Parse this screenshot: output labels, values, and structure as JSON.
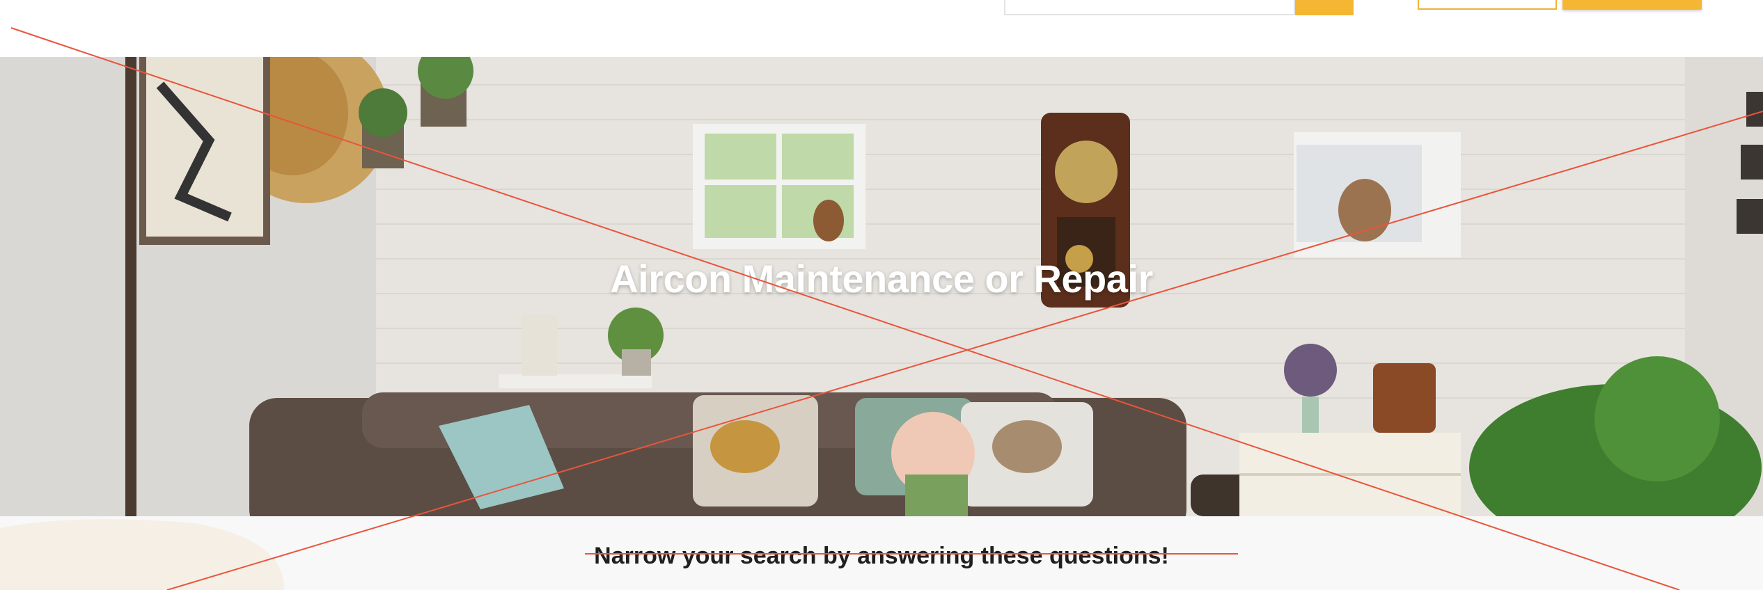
{
  "header": {
    "search": {
      "value": "",
      "placeholder": "",
      "button_icon": "search-icon"
    },
    "secondary_button_label": "",
    "primary_button_label": ""
  },
  "hero": {
    "title": "Aircon Maintenance or Repair"
  },
  "questions": {
    "heading": "Narrow your search by answering these questions!"
  },
  "colors": {
    "accent": "#f5b633",
    "hero_wall": "#e9e6e1",
    "section_bg": "#f8f8f8",
    "overlay_line": "#e8553c",
    "text_dark": "#1f1f1f"
  }
}
